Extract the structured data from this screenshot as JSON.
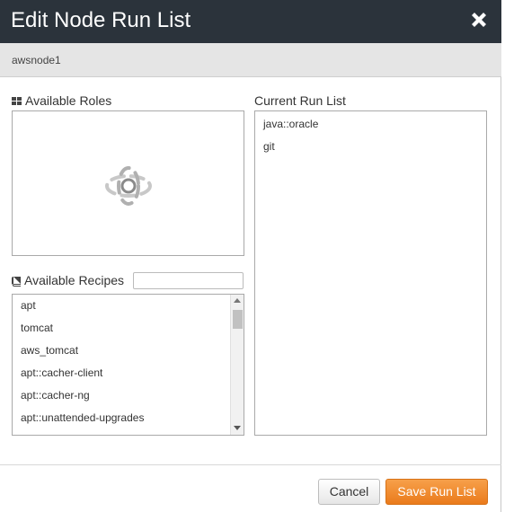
{
  "dialog": {
    "title": "Edit Node Run List",
    "node_name": "awsnode1"
  },
  "available_roles": {
    "label": "Available Roles",
    "icon": "grid-icon",
    "state": "loading"
  },
  "available_recipes": {
    "label": "Available Recipes",
    "icon": "book-icon",
    "filter_value": "",
    "items": [
      {
        "label": "apt"
      },
      {
        "label": "tomcat"
      },
      {
        "label": "aws_tomcat"
      },
      {
        "label": "apt::cacher-client"
      },
      {
        "label": "apt::cacher-ng"
      },
      {
        "label": "apt::unattended-upgrades"
      }
    ]
  },
  "current_run_list": {
    "label": "Current Run List",
    "items": [
      {
        "label": "java::oracle"
      },
      {
        "label": "git"
      }
    ]
  },
  "buttons": {
    "cancel_label": "Cancel",
    "save_label": "Save Run List"
  },
  "colors": {
    "header_bg": "#2b333b",
    "save_accent": "#ea7b1c",
    "subheader_bg": "#e5e5e5"
  }
}
